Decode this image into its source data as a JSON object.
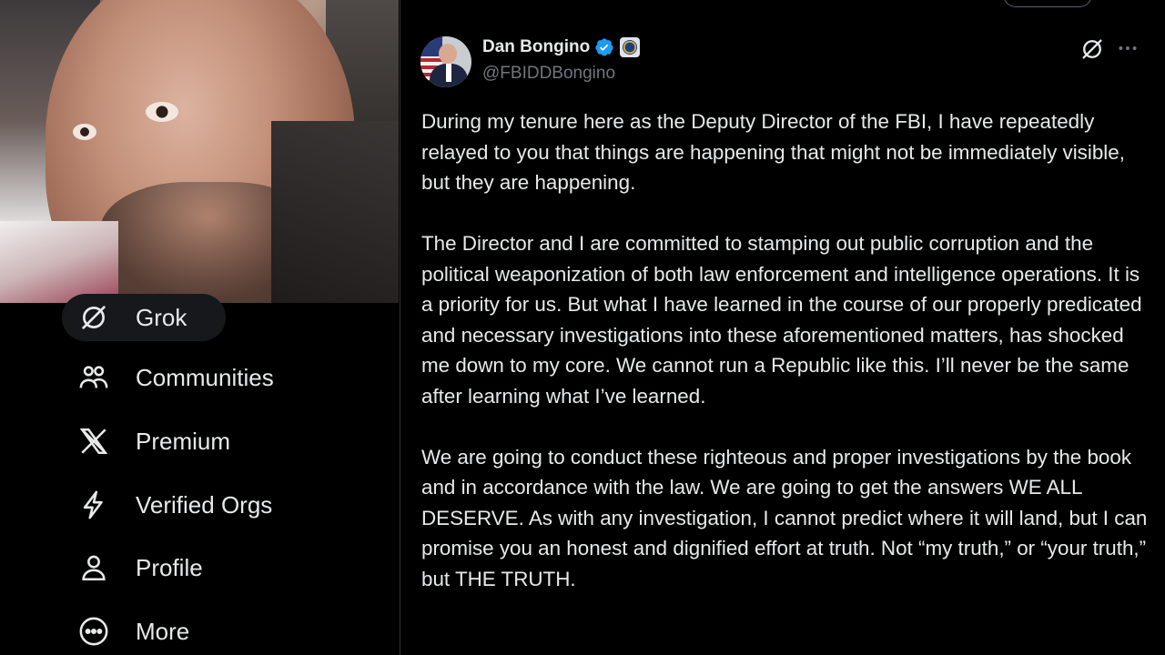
{
  "nav": {
    "items": [
      {
        "label": "Grok",
        "icon": "grok-icon",
        "active": true
      },
      {
        "label": "Communities",
        "icon": "communities-icon",
        "active": false
      },
      {
        "label": "Premium",
        "icon": "x-logo-icon",
        "active": false
      },
      {
        "label": "Verified Orgs",
        "icon": "lightning-icon",
        "active": false
      },
      {
        "label": "Profile",
        "icon": "person-icon",
        "active": false
      },
      {
        "label": "More",
        "icon": "more-circle-icon",
        "active": false
      }
    ]
  },
  "post": {
    "display_name": "Dan Bongino",
    "handle": "@FBIDDBongino",
    "verified_icon": "verified-badge-icon",
    "affiliation_icon": "fbi-seal-icon",
    "paragraphs": [
      "During my tenure here as the Deputy Director of the FBI, I have repeatedly relayed to you that things are happening that might not be immediately visible, but they are happening.",
      "The Director and I are committed to stamping out public corruption and the political weaponization of both law enforcement and intelligence operations. It is a priority for us. But what I have learned in the course of our properly predicated and necessary investigations into these aforementioned matters, has shocked me down to my core. We cannot run a Republic like this. I’ll never be the same after learning what I’ve learned.",
      "We are going to conduct these righteous and proper investigations by the book and in accordance with the law. We are going to get the answers WE ALL DESERVE. As with any investigation, I cannot predict where it will land, but I can promise you an honest and dignified effort at truth. Not “my truth,” or “your truth,” but THE TRUTH."
    ]
  },
  "colors": {
    "background": "#000000",
    "text": "#e7e9ea",
    "secondary_text": "#71767b",
    "verified_blue": "#1d9bf0",
    "border": "#2f3336"
  }
}
